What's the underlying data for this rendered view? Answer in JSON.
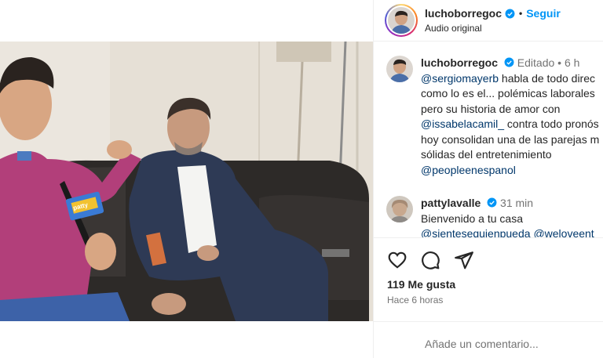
{
  "post": {
    "username": "luchoborregoc",
    "follow_label": "Seguir",
    "audio": "Audio original",
    "separator": "•"
  },
  "comments": [
    {
      "username": "luchoborregoc",
      "edited": "Editado",
      "age": "6 h",
      "lines": [
        {
          "mention": "@sergiomayerb",
          "text": " habla de todo direc"
        },
        {
          "text": "como lo es el... polémicas laborales"
        },
        {
          "text": "pero su historia de amor con"
        },
        {
          "mention": "@issabelacamil_",
          "text": " contra todo pronós"
        },
        {
          "text": "hoy consolidan una de las parejas m"
        },
        {
          "text": "sólidas del entretenimiento"
        },
        {
          "mention": "@peopleenespanol"
        }
      ]
    },
    {
      "username": "pattylavalle",
      "age": "31 min",
      "lines": [
        {
          "text": "Bienvenido a tu casa"
        },
        {
          "mention": "@sientesequienpueda",
          "mention2": "@weloveent"
        }
      ]
    }
  ],
  "video_badge": "patty",
  "likes": "119 Me gusta",
  "time_ago": "Hace 6 horas",
  "add_comment_placeholder": "Añade un comentario...",
  "colors": {
    "link_blue": "#0095f6",
    "mention": "#00376b",
    "verified": "#0095f6",
    "muted": "#737373"
  },
  "icons": [
    "heart-icon",
    "comment-icon",
    "share-icon",
    "verified-icon",
    "mute-icon"
  ]
}
